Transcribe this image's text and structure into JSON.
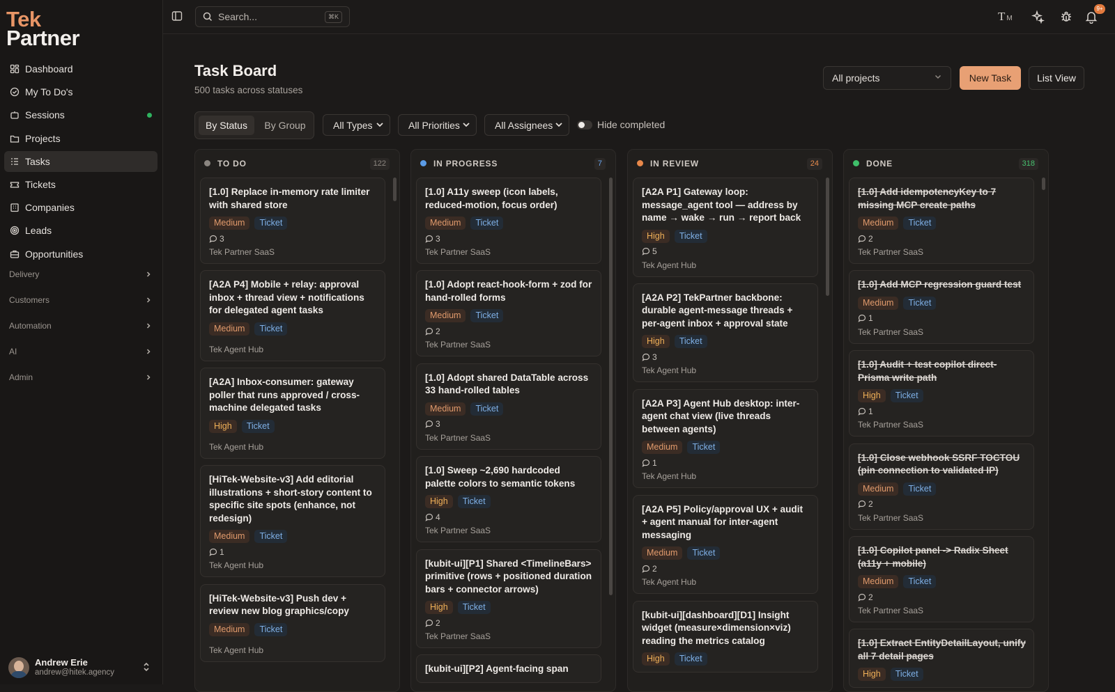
{
  "app": {
    "logo_line1": "Tek",
    "logo_line2": "Partner"
  },
  "sidebar": {
    "items": [
      {
        "label": "Dashboard",
        "icon": "dashboard-icon"
      },
      {
        "label": "My To Do's",
        "icon": "check-circle-icon"
      },
      {
        "label": "Sessions",
        "icon": "sessions-icon",
        "status": "online"
      },
      {
        "label": "Projects",
        "icon": "folder-icon"
      },
      {
        "label": "Tasks",
        "icon": "tasks-icon",
        "active": true
      },
      {
        "label": "Tickets",
        "icon": "ticket-icon"
      },
      {
        "label": "Companies",
        "icon": "building-icon"
      },
      {
        "label": "Leads",
        "icon": "target-icon"
      },
      {
        "label": "Opportunities",
        "icon": "briefcase-icon"
      }
    ],
    "sections": [
      "Delivery",
      "Customers",
      "Automation",
      "AI",
      "Admin"
    ],
    "user": {
      "name": "Andrew Erie",
      "email": "andrew@hitek.agency"
    }
  },
  "topbar": {
    "search_placeholder": "Search...",
    "search_shortcut": "⌘K",
    "font_label": "M",
    "notification_count": "9+"
  },
  "main": {
    "title": "Task Board",
    "subtitle": "500 tasks across statuses",
    "project_select": "All projects",
    "new_task": "New Task",
    "list_view": "List View",
    "group_modes": [
      "By Status",
      "By Group"
    ],
    "filters": [
      "All Types",
      "All Priorities",
      "All Assignees"
    ],
    "hide_completed": "Hide completed"
  },
  "colors": {
    "accent": "#e8a074",
    "todo": "#8a8580",
    "in_progress": "#5b9be6",
    "in_review": "#e8884a",
    "done": "#3fbf6a"
  },
  "columns": [
    {
      "name": "TO DO",
      "count": "122",
      "cards": [
        {
          "title": "[1.0] Replace in-memory rate limiter with shared store",
          "priority": "Medium",
          "type": "Ticket",
          "comments": "3",
          "project": "Tek Partner SaaS"
        },
        {
          "title": "[A2A P4] Mobile + relay: approval inbox + thread view + notifications for delegated agent tasks",
          "priority": "Medium",
          "type": "Ticket",
          "comments": "",
          "project": "Tek Agent Hub"
        },
        {
          "title": "[A2A] Inbox-consumer: gateway poller that runs approved / cross-machine delegated tasks",
          "priority": "High",
          "type": "Ticket",
          "comments": "",
          "project": "Tek Agent Hub"
        },
        {
          "title": "[HiTek-Website-v3] Add editorial illustrations + short-story content to specific site spots (enhance, not redesign)",
          "priority": "Medium",
          "type": "Ticket",
          "comments": "1",
          "project": "Tek Agent Hub"
        },
        {
          "title": "[HiTek-Website-v3] Push dev + review new blog graphics/copy",
          "priority": "Medium",
          "type": "Ticket",
          "comments": "",
          "project": "Tek Agent Hub"
        }
      ]
    },
    {
      "name": "IN PROGRESS",
      "count": "7",
      "cards": [
        {
          "title": "[1.0] A11y sweep (icon labels, reduced-motion, focus order)",
          "priority": "Medium",
          "type": "Ticket",
          "comments": "3",
          "project": "Tek Partner SaaS"
        },
        {
          "title": "[1.0] Adopt react-hook-form + zod for hand-rolled forms",
          "priority": "Medium",
          "type": "Ticket",
          "comments": "2",
          "project": "Tek Partner SaaS"
        },
        {
          "title": "[1.0] Adopt shared DataTable across 33 hand-rolled tables",
          "priority": "Medium",
          "type": "Ticket",
          "comments": "3",
          "project": "Tek Partner SaaS"
        },
        {
          "title": "[1.0] Sweep ~2,690 hardcoded palette colors to semantic tokens",
          "priority": "High",
          "type": "Ticket",
          "comments": "4",
          "project": "Tek Partner SaaS"
        },
        {
          "title": "[kubit-ui][P1] Shared <TimelineBars> primitive (rows + positioned duration bars + connector arrows)",
          "priority": "High",
          "type": "Ticket",
          "comments": "2",
          "project": "Tek Partner SaaS"
        },
        {
          "title": "[kubit-ui][P2] Agent-facing span",
          "priority": "",
          "type": "",
          "comments": "",
          "project": ""
        }
      ]
    },
    {
      "name": "IN REVIEW",
      "count": "24",
      "cards": [
        {
          "title": "[A2A P1] Gateway loop: message_agent tool — address by name → wake → run → report back",
          "priority": "High",
          "type": "Ticket",
          "comments": "5",
          "project": "Tek Agent Hub"
        },
        {
          "title": "[A2A P2] TekPartner backbone: durable agent-message threads + per-agent inbox + approval state",
          "priority": "High",
          "type": "Ticket",
          "comments": "3",
          "project": "Tek Agent Hub"
        },
        {
          "title": "[A2A P3] Agent Hub desktop: inter-agent chat view (live threads between agents)",
          "priority": "Medium",
          "type": "Ticket",
          "comments": "1",
          "project": "Tek Agent Hub"
        },
        {
          "title": "[A2A P5] Policy/approval UX + audit + agent manual for inter-agent messaging",
          "priority": "Medium",
          "type": "Ticket",
          "comments": "2",
          "project": "Tek Agent Hub"
        },
        {
          "title": "[kubit-ui][dashboard][D1] Insight widget (measure×dimension×viz) reading the metrics catalog",
          "priority": "High",
          "type": "Ticket",
          "comments": "",
          "project": ""
        }
      ]
    },
    {
      "name": "DONE",
      "count": "318",
      "cards": [
        {
          "title": "[1.0] Add idempotencyKey to 7 missing MCP create paths",
          "priority": "Medium",
          "type": "Ticket",
          "comments": "2",
          "project": "Tek Partner SaaS"
        },
        {
          "title": "[1.0] Add MCP regression guard test",
          "priority": "Medium",
          "type": "Ticket",
          "comments": "1",
          "project": "Tek Partner SaaS"
        },
        {
          "title": "[1.0] Audit + test copilot direct-Prisma write path",
          "priority": "High",
          "type": "Ticket",
          "comments": "1",
          "project": "Tek Partner SaaS"
        },
        {
          "title": "[1.0] Close webhook SSRF TOCTOU (pin connection to validated IP)",
          "priority": "Medium",
          "type": "Ticket",
          "comments": "2",
          "project": "Tek Partner SaaS"
        },
        {
          "title": "[1.0] Copilot panel -> Radix Sheet (a11y + mobile)",
          "priority": "Medium",
          "type": "Ticket",
          "comments": "2",
          "project": "Tek Partner SaaS"
        },
        {
          "title": "[1.0] Extract EntityDetailLayout, unify all 7 detail pages",
          "priority": "High",
          "type": "Ticket",
          "comments": "",
          "project": ""
        }
      ]
    }
  ]
}
